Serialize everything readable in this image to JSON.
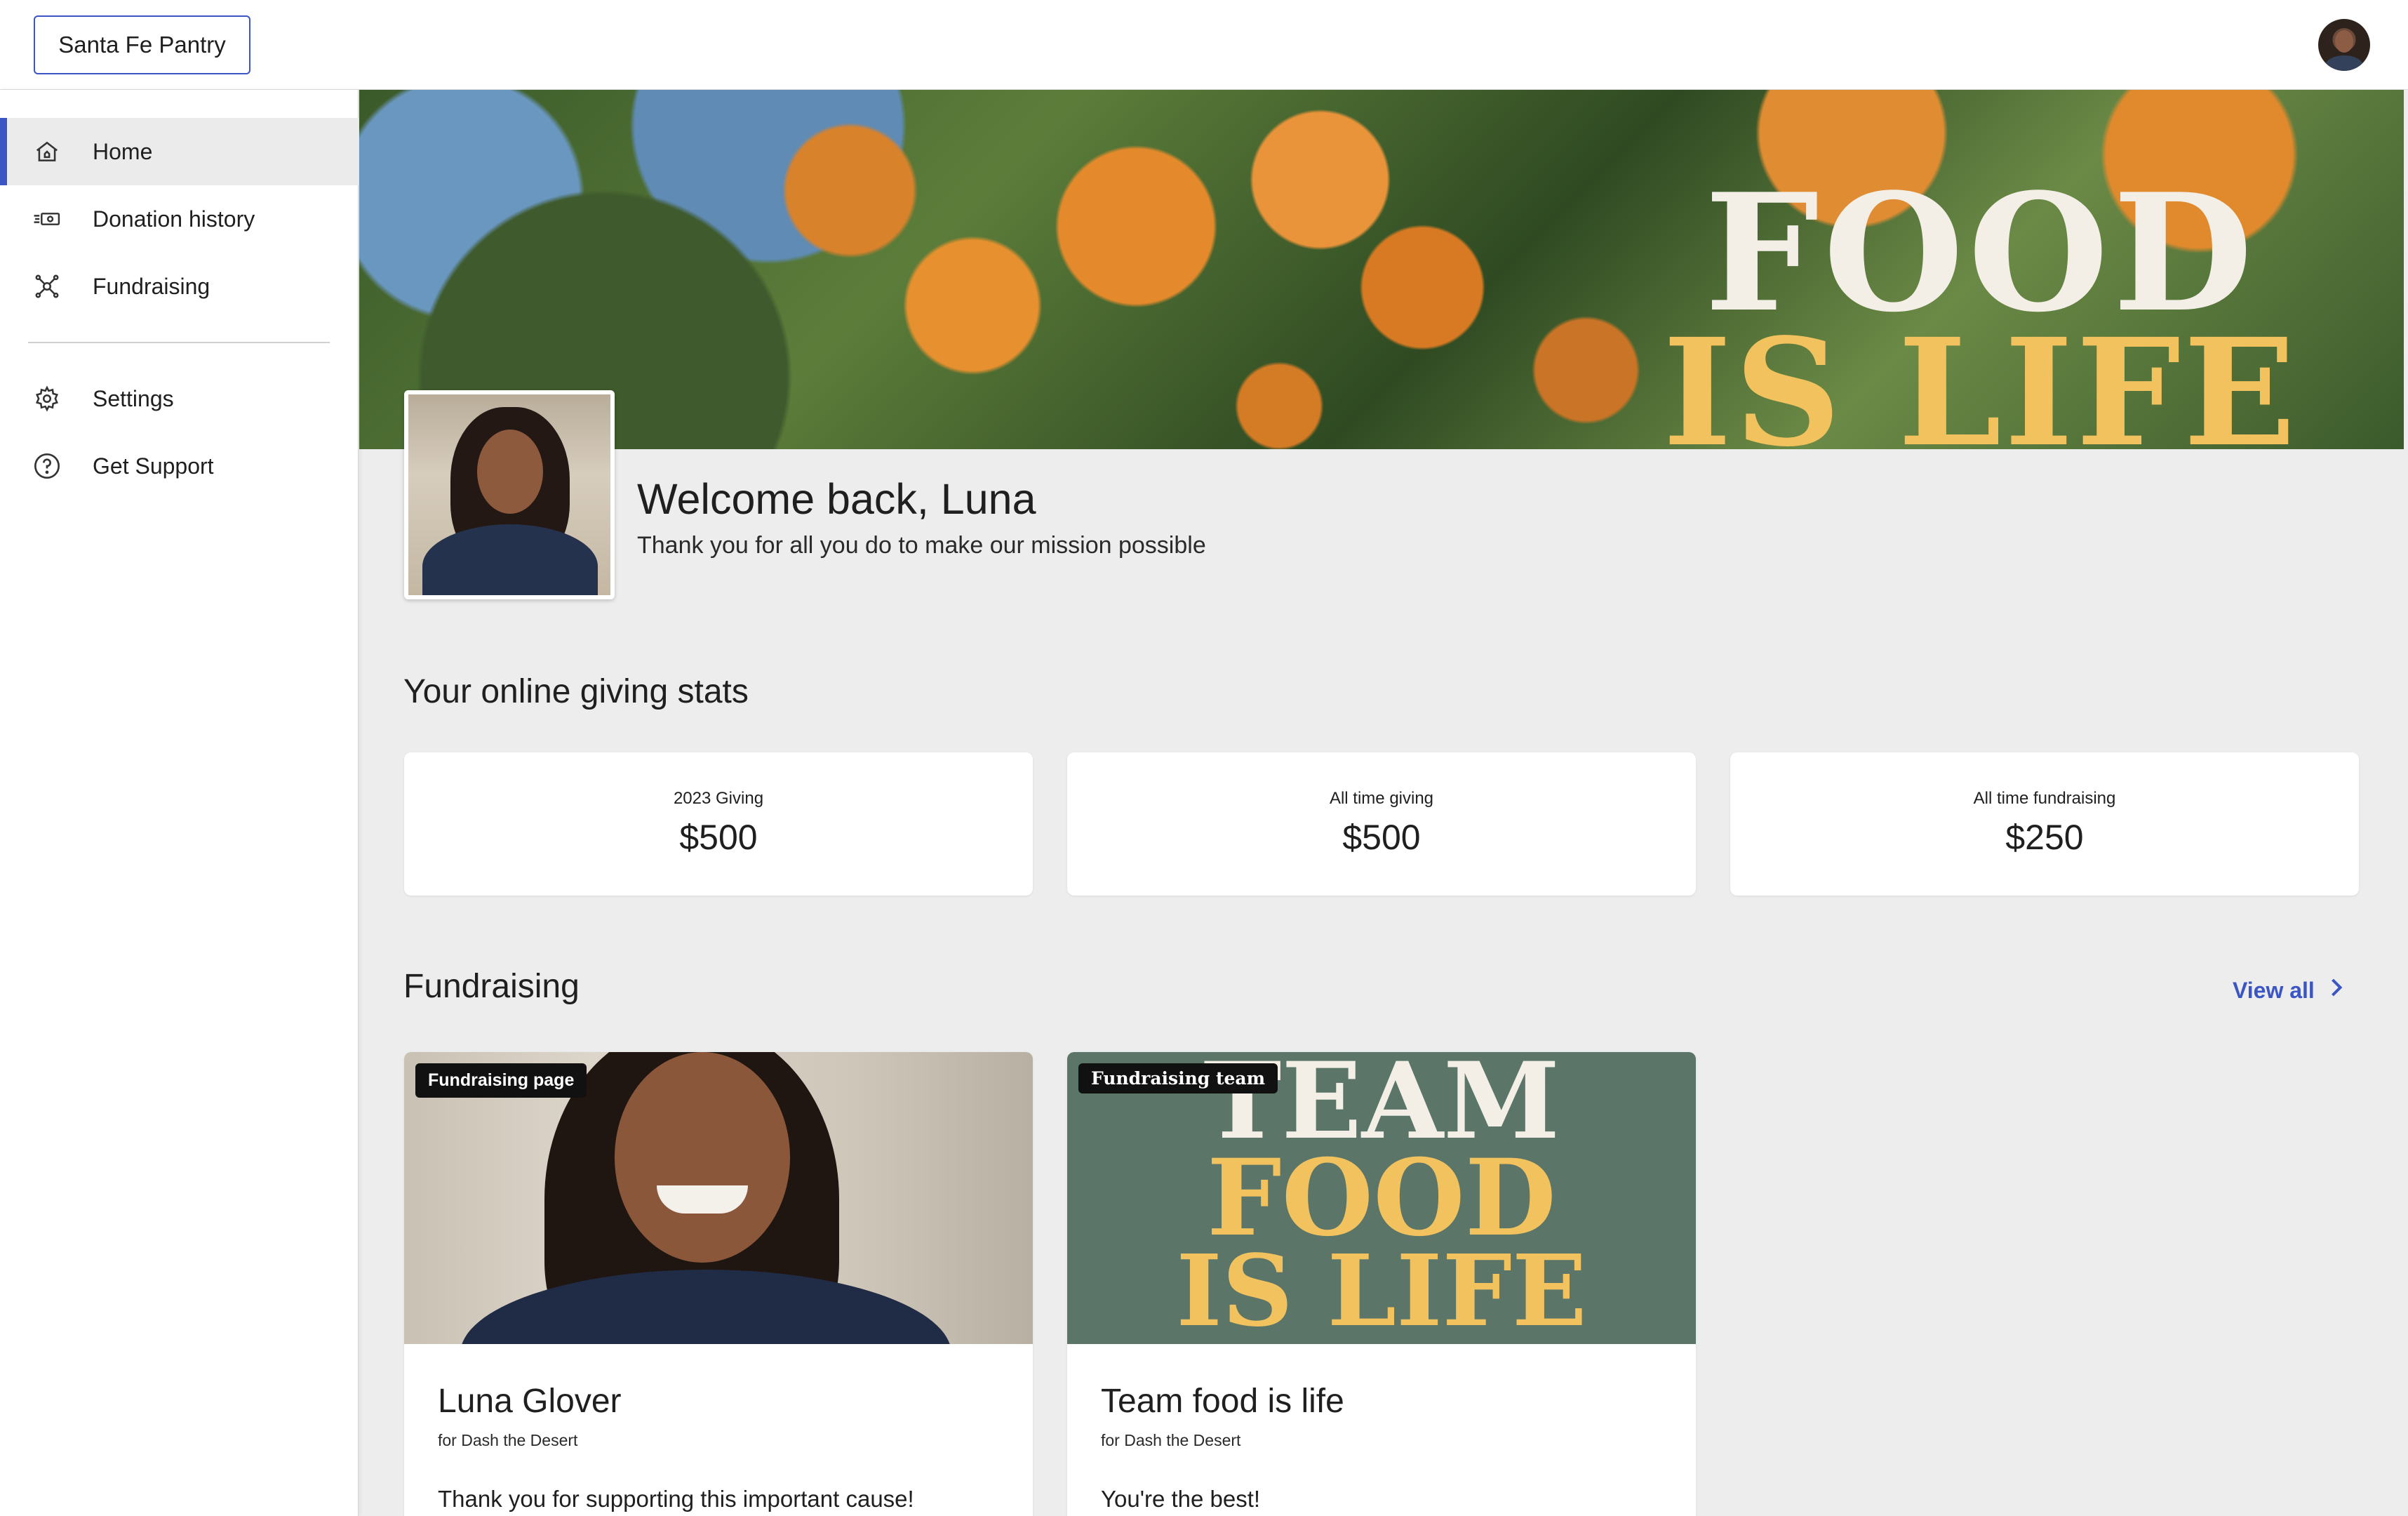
{
  "header": {
    "org_name": "Santa Fe Pantry",
    "avatar_icon": "user-avatar"
  },
  "sidebar": {
    "items": [
      {
        "label": "Home",
        "icon": "home-icon",
        "active": true
      },
      {
        "label": "Donation history",
        "icon": "cash-icon",
        "active": false
      },
      {
        "label": "Fundraising",
        "icon": "fundraising-icon",
        "active": false
      },
      {
        "label": "Settings",
        "icon": "gear-icon",
        "active": false
      },
      {
        "label": "Get Support",
        "icon": "help-icon",
        "active": false
      }
    ]
  },
  "banner": {
    "line1": "FOOD",
    "line2": "IS LIFE"
  },
  "welcome": {
    "title": "Welcome back, Luna",
    "subtitle": "Thank you for all you do to make our mission possible"
  },
  "stats": {
    "title": "Your online giving stats",
    "cards": [
      {
        "label": "2023 Giving",
        "value": "$500"
      },
      {
        "label": "All time giving",
        "value": "$500"
      },
      {
        "label": "All time fundraising",
        "value": "$250"
      }
    ]
  },
  "fundraising": {
    "title": "Fundraising",
    "view_all": "View all",
    "cards": [
      {
        "badge": "Fundraising page",
        "title": "Luna Glover",
        "subtitle": "for Dash the Desert",
        "message": "Thank you for supporting this important cause!"
      },
      {
        "badge": "Fundraising team",
        "title": "Team food is life",
        "subtitle": "for Dash the Desert",
        "message": "You're the best!",
        "image_lines": [
          "TEAM",
          "FOOD",
          "IS LIFE"
        ]
      }
    ]
  },
  "colors": {
    "accent": "#3b56c4",
    "page_bg": "#ededed",
    "banner_yellow": "#f2c25e",
    "team_green": "#5b7568"
  }
}
